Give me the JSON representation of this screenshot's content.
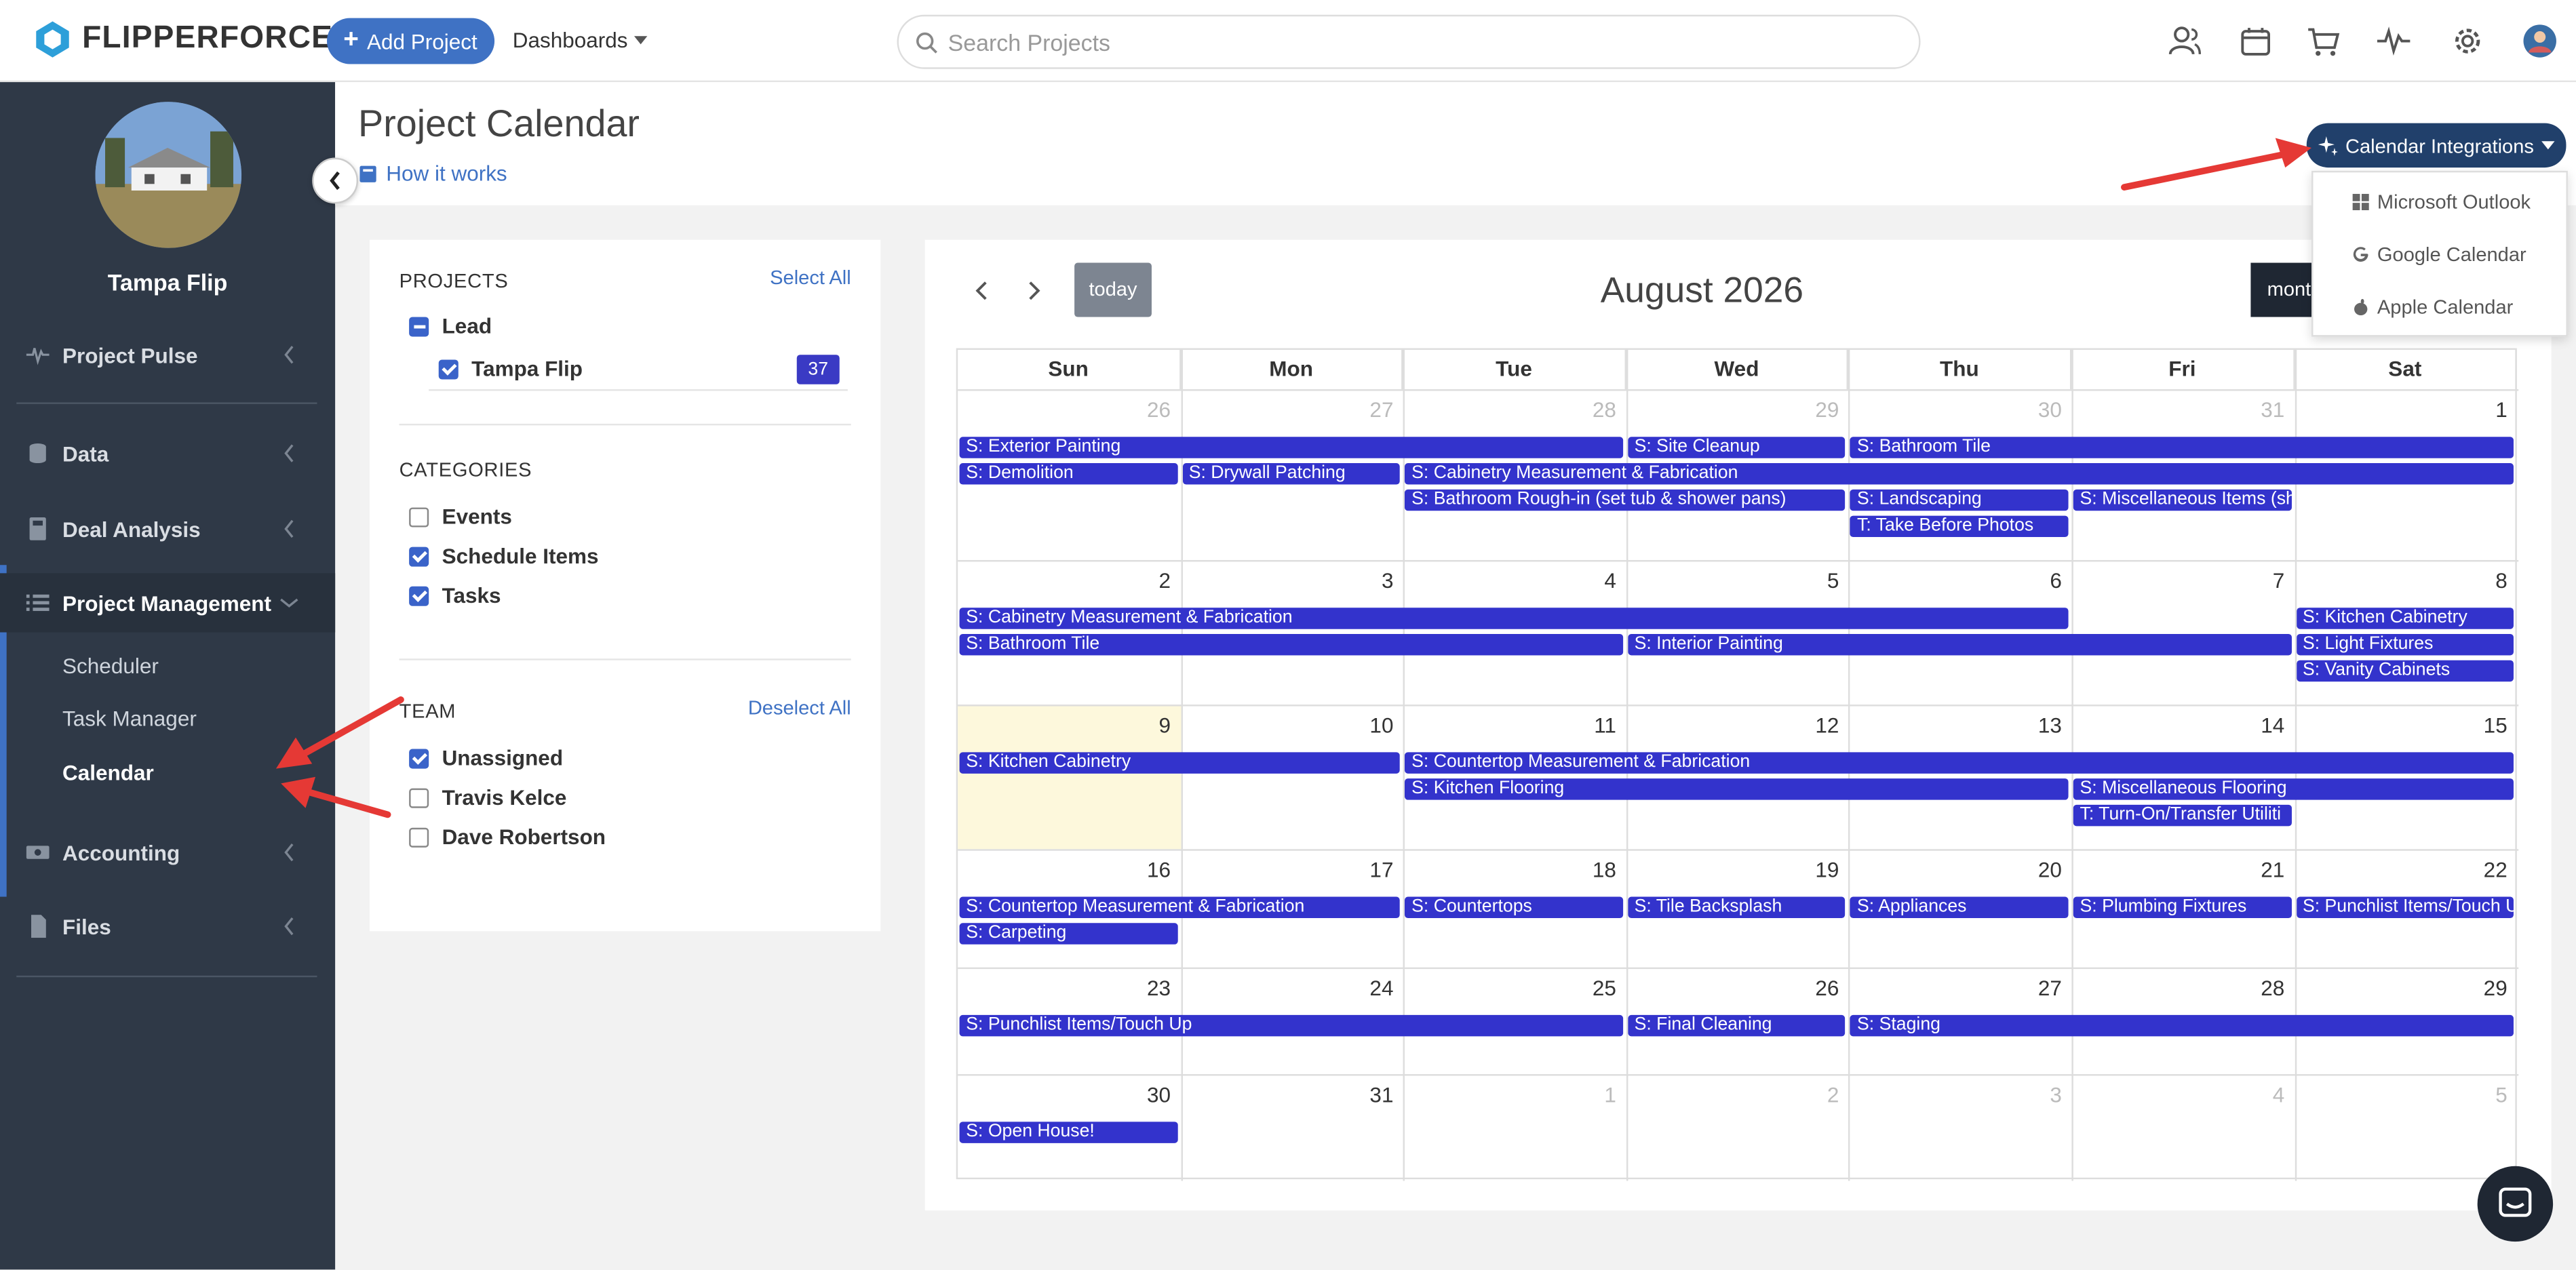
{
  "app": {
    "logo_text": "FLIPPERFORCE",
    "add_project_label": "Add Project",
    "dashboards_label": "Dashboards",
    "search_placeholder": "Search Projects",
    "top_icons": [
      "team-icon",
      "calendar-icon",
      "cart-icon",
      "pulse-icon",
      "gear-icon",
      "user-avatar-icon"
    ]
  },
  "sidebar": {
    "project_name": "Tampa Flip",
    "items": [
      {
        "label": "Project Pulse",
        "icon": "pulse-icon"
      },
      {
        "label": "Data",
        "icon": "database-icon"
      },
      {
        "label": "Deal Analysis",
        "icon": "calculator-icon"
      },
      {
        "label": "Project Management",
        "icon": "list-icon"
      },
      {
        "label": "Accounting",
        "icon": "money-icon"
      },
      {
        "label": "Files",
        "icon": "file-icon"
      }
    ],
    "sub_items": [
      "Scheduler",
      "Task Manager",
      "Calendar"
    ]
  },
  "page": {
    "title": "Project Calendar",
    "how_it_works": "How it works"
  },
  "filters": {
    "projects_heading": "PROJECTS",
    "select_all": "Select All",
    "lead_label": "Lead",
    "project_label": "Tampa Flip",
    "project_count": "37",
    "categories_heading": "CATEGORIES",
    "categories": [
      {
        "label": "Events",
        "checked": false
      },
      {
        "label": "Schedule Items",
        "checked": true
      },
      {
        "label": "Tasks",
        "checked": true
      }
    ],
    "team_heading": "TEAM",
    "deselect_all": "Deselect All",
    "team": [
      {
        "label": "Unassigned",
        "checked": true
      },
      {
        "label": "Travis Kelce",
        "checked": false
      },
      {
        "label": "Dave Robertson",
        "checked": false
      }
    ]
  },
  "calendar": {
    "today_label": "today",
    "month_title": "August 2026",
    "view_label": "month",
    "days_of_week": [
      "Sun",
      "Mon",
      "Tue",
      "Wed",
      "Thu",
      "Fri",
      "Sat"
    ],
    "weeks": [
      [
        {
          "d": "26",
          "o": true
        },
        {
          "d": "27",
          "o": true
        },
        {
          "d": "28",
          "o": true
        },
        {
          "d": "29",
          "o": true
        },
        {
          "d": "30",
          "o": true
        },
        {
          "d": "31",
          "o": true
        },
        {
          "d": "1",
          "o": false
        }
      ],
      [
        {
          "d": "2",
          "o": false
        },
        {
          "d": "3",
          "o": false
        },
        {
          "d": "4",
          "o": false
        },
        {
          "d": "5",
          "o": false
        },
        {
          "d": "6",
          "o": false
        },
        {
          "d": "7",
          "o": false
        },
        {
          "d": "8",
          "o": false
        }
      ],
      [
        {
          "d": "9",
          "o": false
        },
        {
          "d": "10",
          "o": false
        },
        {
          "d": "11",
          "o": false
        },
        {
          "d": "12",
          "o": false
        },
        {
          "d": "13",
          "o": false
        },
        {
          "d": "14",
          "o": false
        },
        {
          "d": "15",
          "o": false
        }
      ],
      [
        {
          "d": "16",
          "o": false
        },
        {
          "d": "17",
          "o": false
        },
        {
          "d": "18",
          "o": false
        },
        {
          "d": "19",
          "o": false
        },
        {
          "d": "20",
          "o": false
        },
        {
          "d": "21",
          "o": false
        },
        {
          "d": "22",
          "o": false
        }
      ],
      [
        {
          "d": "23",
          "o": false
        },
        {
          "d": "24",
          "o": false
        },
        {
          "d": "25",
          "o": false
        },
        {
          "d": "26",
          "o": false
        },
        {
          "d": "27",
          "o": false
        },
        {
          "d": "28",
          "o": false
        },
        {
          "d": "29",
          "o": false
        }
      ],
      [
        {
          "d": "30",
          "o": false
        },
        {
          "d": "31",
          "o": false
        },
        {
          "d": "1",
          "o": true
        },
        {
          "d": "2",
          "o": true
        },
        {
          "d": "3",
          "o": true
        },
        {
          "d": "4",
          "o": true
        },
        {
          "d": "5",
          "o": true
        }
      ]
    ],
    "events": [
      {
        "week": 0,
        "start": 0,
        "span": 3,
        "lane": 0,
        "text": "S:  Exterior Painting"
      },
      {
        "week": 0,
        "start": 3,
        "span": 1,
        "lane": 0,
        "text": "S:  Site Cleanup"
      },
      {
        "week": 0,
        "start": 4,
        "span": 3,
        "lane": 0,
        "text": "S:  Bathroom Tile"
      },
      {
        "week": 0,
        "start": 0,
        "span": 1,
        "lane": 1,
        "text": "S:  Demolition"
      },
      {
        "week": 0,
        "start": 1,
        "span": 1,
        "lane": 1,
        "text": "S:  Drywall Patching"
      },
      {
        "week": 0,
        "start": 2,
        "span": 5,
        "lane": 1,
        "text": "S:  Cabinetry Measurement & Fabrication"
      },
      {
        "week": 0,
        "start": 2,
        "span": 2,
        "lane": 2,
        "text": "S:  Bathroom Rough-in (set tub & shower pans)"
      },
      {
        "week": 0,
        "start": 4,
        "span": 1,
        "lane": 2,
        "text": "S:  Landscaping"
      },
      {
        "week": 0,
        "start": 5,
        "span": 1,
        "lane": 2,
        "text": "S:  Miscellaneous Items (sh"
      },
      {
        "week": 0,
        "start": 4,
        "span": 1,
        "lane": 3,
        "text": "T:  Take Before Photos"
      },
      {
        "week": 1,
        "start": 0,
        "span": 5,
        "lane": 0,
        "text": "S:  Cabinetry Measurement & Fabrication"
      },
      {
        "week": 1,
        "start": 6,
        "span": 1,
        "lane": 0,
        "text": "S:  Kitchen Cabinetry"
      },
      {
        "week": 1,
        "start": 0,
        "span": 3,
        "lane": 1,
        "text": "S:  Bathroom Tile"
      },
      {
        "week": 1,
        "start": 3,
        "span": 3,
        "lane": 1,
        "text": "S:  Interior Painting"
      },
      {
        "week": 1,
        "start": 6,
        "span": 1,
        "lane": 1,
        "text": "S:  Light Fixtures"
      },
      {
        "week": 1,
        "start": 6,
        "span": 1,
        "lane": 2,
        "text": "S:  Vanity Cabinets"
      },
      {
        "week": 2,
        "start": 0,
        "span": 2,
        "lane": 0,
        "text": "S:  Kitchen Cabinetry"
      },
      {
        "week": 2,
        "start": 2,
        "span": 5,
        "lane": 0,
        "text": "S:  Countertop Measurement & Fabrication"
      },
      {
        "week": 2,
        "start": 2,
        "span": 3,
        "lane": 1,
        "text": "S:  Kitchen Flooring"
      },
      {
        "week": 2,
        "start": 5,
        "span": 2,
        "lane": 1,
        "text": "S:  Miscellaneous Flooring"
      },
      {
        "week": 2,
        "start": 5,
        "span": 1,
        "lane": 2,
        "text": "T:  Turn-On/Transfer Utiliti"
      },
      {
        "week": 3,
        "start": 0,
        "span": 2,
        "lane": 0,
        "text": "S:  Countertop Measurement & Fabrication"
      },
      {
        "week": 3,
        "start": 2,
        "span": 1,
        "lane": 0,
        "text": "S:  Countertops"
      },
      {
        "week": 3,
        "start": 3,
        "span": 1,
        "lane": 0,
        "text": "S:  Tile Backsplash"
      },
      {
        "week": 3,
        "start": 4,
        "span": 1,
        "lane": 0,
        "text": "S:  Appliances"
      },
      {
        "week": 3,
        "start": 5,
        "span": 1,
        "lane": 0,
        "text": "S:  Plumbing Fixtures"
      },
      {
        "week": 3,
        "start": 6,
        "span": 1,
        "lane": 0,
        "text": "S:  Punchlist Items/Touch U"
      },
      {
        "week": 3,
        "start": 0,
        "span": 1,
        "lane": 1,
        "text": "S:  Carpeting"
      },
      {
        "week": 4,
        "start": 0,
        "span": 3,
        "lane": 0,
        "text": "S:  Punchlist Items/Touch Up"
      },
      {
        "week": 4,
        "start": 3,
        "span": 1,
        "lane": 0,
        "text": "S:  Final Cleaning"
      },
      {
        "week": 4,
        "start": 4,
        "span": 3,
        "lane": 0,
        "text": "S:  Staging"
      },
      {
        "week": 5,
        "start": 0,
        "span": 1,
        "lane": 0,
        "text": "S:  Open House!"
      }
    ]
  },
  "integrations": {
    "button_label": "Calendar Integrations",
    "options": [
      {
        "label": "Microsoft Outlook",
        "icon": "windows-icon"
      },
      {
        "label": "Google Calendar",
        "icon": "google-icon"
      },
      {
        "label": "Apple Calendar",
        "icon": "apple-icon"
      }
    ]
  },
  "colors": {
    "event": "#3333cc",
    "sidebar": "#2f3947",
    "accent": "#3f72c4",
    "today": "#fdf8dc",
    "annotation_arrow": "#e53935"
  }
}
